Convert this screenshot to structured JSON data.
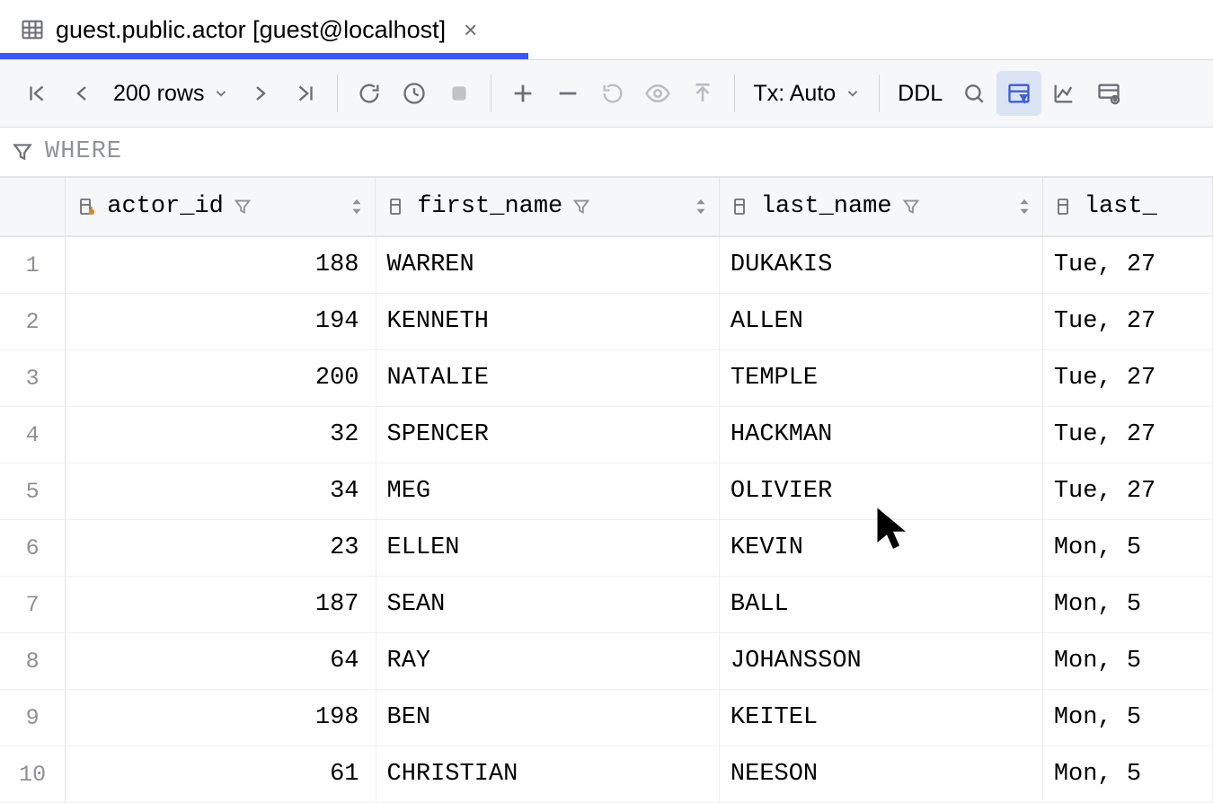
{
  "tab": {
    "title": "guest.public.actor [guest@localhost]"
  },
  "toolbar": {
    "rows_label": "200 rows",
    "tx_label": "Tx: Auto",
    "ddl_label": "DDL"
  },
  "filter": {
    "where_label": "WHERE"
  },
  "columns": {
    "actor_id": "actor_id",
    "first_name": "first_name",
    "last_name": "last_name",
    "last_update": "last_"
  },
  "rows": [
    {
      "n": "1",
      "actor_id": "188",
      "first_name": "WARREN",
      "last_name": "DUKAKIS",
      "last_update": "Tue, 27"
    },
    {
      "n": "2",
      "actor_id": "194",
      "first_name": "KENNETH",
      "last_name": "ALLEN",
      "last_update": "Tue, 27"
    },
    {
      "n": "3",
      "actor_id": "200",
      "first_name": "NATALIE",
      "last_name": "TEMPLE",
      "last_update": "Tue, 27"
    },
    {
      "n": "4",
      "actor_id": "32",
      "first_name": "SPENCER",
      "last_name": "HACKMAN",
      "last_update": "Tue, 27"
    },
    {
      "n": "5",
      "actor_id": "34",
      "first_name": "MEG",
      "last_name": "OLIVIER",
      "last_update": "Tue, 27"
    },
    {
      "n": "6",
      "actor_id": "23",
      "first_name": "ELLEN",
      "last_name": "KEVIN",
      "last_update": "Mon, 5"
    },
    {
      "n": "7",
      "actor_id": "187",
      "first_name": "SEAN",
      "last_name": "BALL",
      "last_update": "Mon, 5"
    },
    {
      "n": "8",
      "actor_id": "64",
      "first_name": "RAY",
      "last_name": "JOHANSSON",
      "last_update": "Mon, 5"
    },
    {
      "n": "9",
      "actor_id": "198",
      "first_name": "BEN",
      "last_name": "KEITEL",
      "last_update": "Mon, 5"
    },
    {
      "n": "10",
      "actor_id": "61",
      "first_name": "CHRISTIAN",
      "last_name": "NEESON",
      "last_update": "Mon, 5"
    }
  ]
}
